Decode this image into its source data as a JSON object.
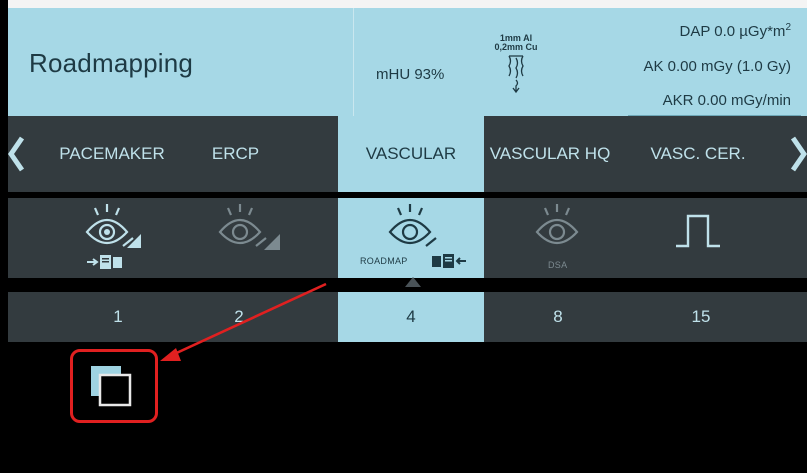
{
  "header": {
    "title": "Roadmapping",
    "mhu": "mHU 93%",
    "filter_line1": "1mm Al",
    "filter_line2": "0,2mm Cu",
    "dap_label": "DAP 0.0 µGy*m",
    "dap_sup": "2",
    "ak": "AK 0.00 mGy  (1.0 Gy)",
    "akr": "AKR 0.00 mGy/min"
  },
  "tabs": [
    {
      "label": "PACEMAKER"
    },
    {
      "label": "ERCP"
    },
    {
      "label": "VASCULAR"
    },
    {
      "label": "VASCULAR HQ"
    },
    {
      "label": "VASC. CER."
    }
  ],
  "active_tab": "VASCULAR",
  "modes": [
    {
      "icon": "eye-fluoro-store-icon",
      "label": ""
    },
    {
      "icon": "eye-fluoro-icon",
      "label": ""
    },
    {
      "icon": "eye-roadmap-icon",
      "label": "ROADMAP"
    },
    {
      "icon": "eye-dsa-icon",
      "label": "DSA"
    },
    {
      "icon": "pulse-icon",
      "label": ""
    }
  ],
  "active_mode": "ROADMAP",
  "numbers": [
    "1",
    "2",
    "4",
    "8",
    "15"
  ],
  "active_number": "4",
  "colors": {
    "accent": "#a6d8e6",
    "dark_panel": "#333b3f",
    "highlight": "#e02020"
  }
}
